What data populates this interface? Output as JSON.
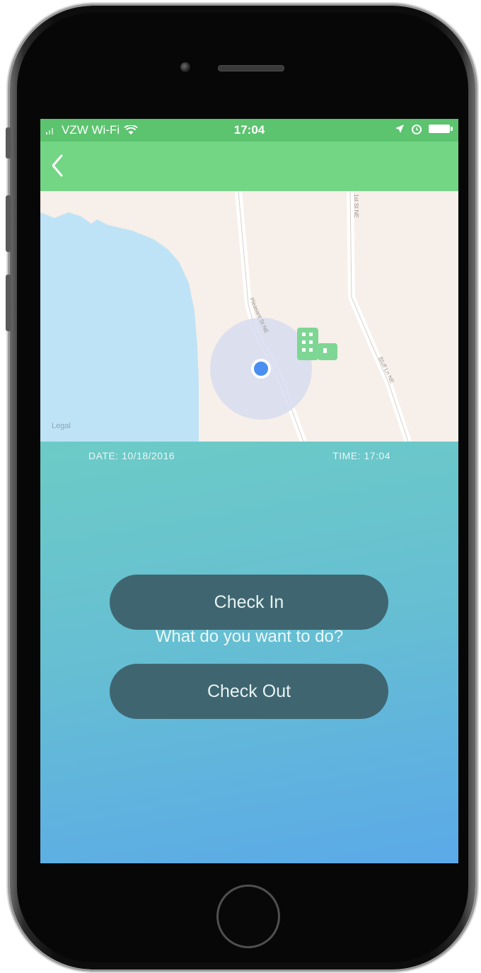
{
  "status_bar": {
    "carrier": "VZW Wi-Fi",
    "time": "17:04"
  },
  "map": {
    "legal_label": "Legal",
    "street_labels": [
      "Pleasant St NE",
      "Bluff Ln NE",
      "1st St NE"
    ]
  },
  "info": {
    "date": "DATE: 10/18/2016",
    "time": "TIME: 17:04"
  },
  "prompt": "What do you want to do?",
  "actions": {
    "check_in": "Check In",
    "check_out": "Check Out"
  },
  "colors": {
    "status_bar": "#5cc36f",
    "nav_bar": "#72d684",
    "button": "#3f6670",
    "gradient_start": "#6ccbc6",
    "gradient_end": "#5ba9e8",
    "location_dot": "#4a8ff0",
    "building_marker": "#7ed694"
  },
  "icons": [
    "back-chevron-icon",
    "wifi-icon",
    "signal-icon",
    "location-arrow-icon",
    "alarm-icon",
    "battery-icon",
    "building-icon",
    "current-location-icon"
  ]
}
